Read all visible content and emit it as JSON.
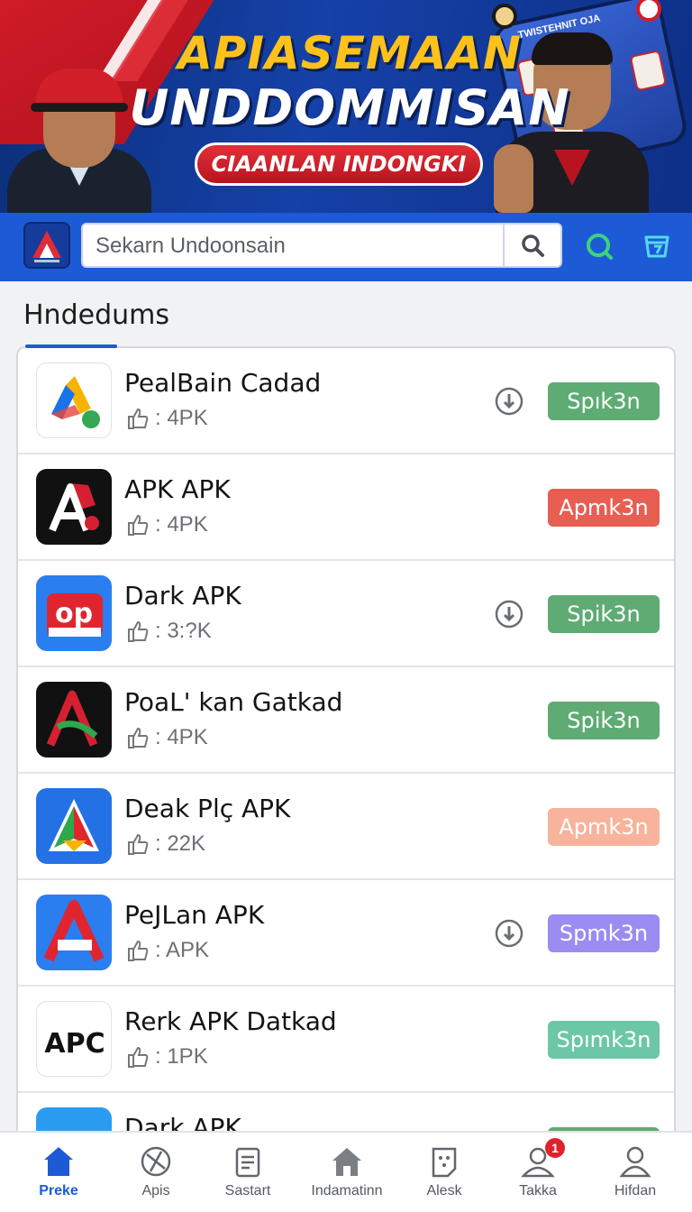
{
  "banner": {
    "title_line1": "APIASEMAAN",
    "title_line2": "UNDDOMMISAN",
    "pill_text": "CIAANLAN INDONGKI",
    "phone_caption": "TWISTEHNIT OJA"
  },
  "search": {
    "placeholder": "Sekarn Undoonsain"
  },
  "section": {
    "title": "Hndedums"
  },
  "apps": [
    {
      "name": "PealBain Cadad",
      "size": ": 4PK",
      "action_label": "Spık3n",
      "action_color": "#5fab74",
      "has_download": true,
      "icon": "google-ads-logo-icon"
    },
    {
      "name": "APK APK",
      "size": ": 4PK",
      "action_label": "Apmk3n",
      "action_color": "#e75e52",
      "has_download": false,
      "icon": "red-a-logo-icon"
    },
    {
      "name": "Dark APK",
      "size": ": 3:?K",
      "action_label": "Spik3n",
      "action_color": "#5fab74",
      "has_download": true,
      "icon": "op-logo-icon"
    },
    {
      "name": "PoaL' kan Gatkad",
      "size": ": 4PK",
      "action_label": "Spik3n",
      "action_color": "#5fab74",
      "has_download": false,
      "icon": "green-red-a-logo-icon"
    },
    {
      "name": "Deak Plç APK",
      "size": ": 22K",
      "action_label": "Apmk3n",
      "action_color": "#f7b39b",
      "has_download": false,
      "icon": "triangle-a-logo-icon"
    },
    {
      "name": "PeJLan APK",
      "size": ": APK",
      "action_label": "Spmk3n",
      "action_color": "#9a8cf0",
      "has_download": true,
      "icon": "blue-a-logo-icon"
    },
    {
      "name": "Rerk APK Datkad",
      "size": ": 1PK",
      "action_label": "Spımk3n",
      "action_color": "#6cc7a6",
      "has_download": false,
      "icon": "apc-logo-icon"
    },
    {
      "name": "Dark APK",
      "size": "",
      "action_label": "",
      "action_color": "#5fab74",
      "has_download": false,
      "icon": "partial-logo-icon"
    }
  ],
  "bottom_nav": [
    {
      "label": "Preke",
      "icon": "home-icon",
      "active": true
    },
    {
      "label": "Apis",
      "icon": "grid-circle-icon",
      "active": false
    },
    {
      "label": "Sastart",
      "icon": "document-icon",
      "active": false
    },
    {
      "label": "Indamatinn",
      "icon": "house-outline-icon",
      "active": false
    },
    {
      "label": "Alesk",
      "icon": "dice-icon",
      "active": false
    },
    {
      "label": "Takka",
      "icon": "person-badge-icon",
      "active": false,
      "badge": "1"
    },
    {
      "label": "Hifdan",
      "icon": "person-icon",
      "active": false
    }
  ],
  "colors": {
    "brand_blue": "#1d5bd6",
    "banner_blue": "#1541a8",
    "accent_red": "#d21d2a",
    "accent_yellow": "#ffc21a"
  }
}
